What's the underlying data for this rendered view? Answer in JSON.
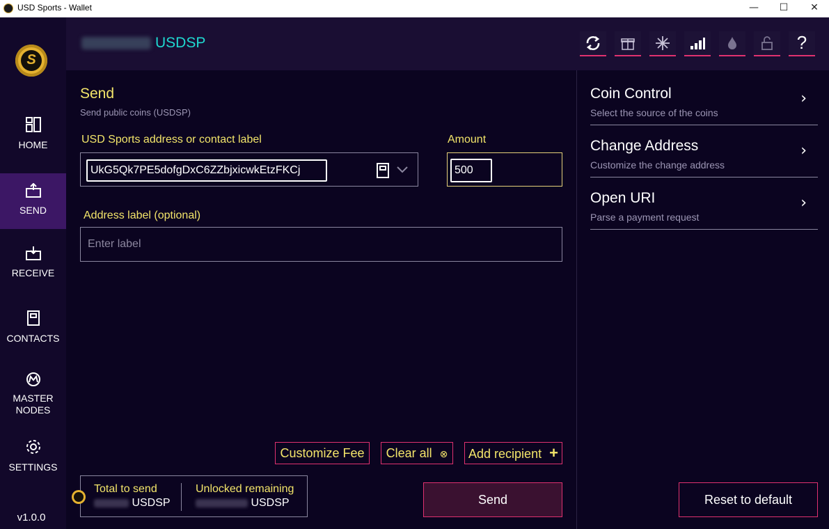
{
  "window": {
    "title": "USD Sports - Wallet",
    "minimize": "—",
    "maximize": "☐",
    "close": "✕"
  },
  "sidebar": {
    "items": [
      {
        "label": "HOME",
        "icon": "home-icon"
      },
      {
        "label": "SEND",
        "icon": "send-icon",
        "active": true
      },
      {
        "label": "RECEIVE",
        "icon": "receive-icon"
      },
      {
        "label": "CONTACTS",
        "icon": "contacts-icon"
      },
      {
        "label_line1": "MASTER",
        "label_line2": "NODES",
        "icon": "masternodes-icon"
      },
      {
        "label": "SETTINGS",
        "icon": "gear-icon"
      }
    ],
    "version": "v1.0.0"
  },
  "header": {
    "balance_unit": "USDSP",
    "toolbar_icons": [
      "sync-icon",
      "gift-icon",
      "snowflake-icon",
      "signal-icon",
      "tor-icon",
      "lock-icon",
      "help-icon"
    ],
    "help_label": "?"
  },
  "send": {
    "title": "Send",
    "subtitle": "Send public coins (USDSP)",
    "address_label": "USD Sports address or contact label",
    "address_value": "UkG5Qk7PE5dofgDxC6ZZbjxicwkEtzFKCj",
    "amount_label": "Amount",
    "amount_value": "500",
    "address_label_optional": "Address label (optional)",
    "label_placeholder": "Enter label",
    "customize_fee": "Customize Fee",
    "clear_all": "Clear all",
    "add_recipient": "Add recipient",
    "total_to_send": "Total to send",
    "unlocked_remaining": "Unlocked remaining",
    "total_unit": "USDSP",
    "remaining_unit": "USDSP",
    "send_button": "Send"
  },
  "right_panel": {
    "options": [
      {
        "title": "Coin Control",
        "subtitle": "Select the source of the coins"
      },
      {
        "title": "Change Address",
        "subtitle": "Customize the change address"
      },
      {
        "title": "Open URI",
        "subtitle": "Parse a payment request"
      }
    ],
    "reset_button": "Reset to default"
  },
  "colors": {
    "accent_pink": "#e0316f",
    "label_yellow": "#f3e56a",
    "unit_cyan": "#1fd8d0",
    "active_nav": "#3c1765"
  }
}
